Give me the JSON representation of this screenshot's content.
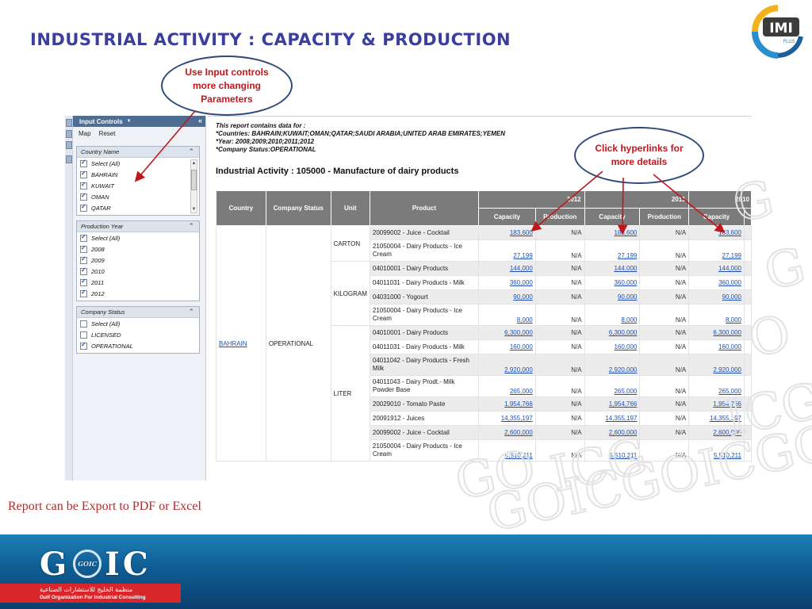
{
  "slide": {
    "title": "INDUSTRIAL ACTIVITY : CAPACITY & PRODUCTION",
    "logo_text": "IMI",
    "logo_sub": "PLUS",
    "export_note": "Report can be Export to PDF or Excel"
  },
  "callouts": {
    "input_controls": "Use Input controls more changing Parameters",
    "hyperlinks": "Click hyperlinks for more details"
  },
  "input_panel": {
    "title": "Input Controls",
    "map_label": "Map",
    "reset_label": "Reset",
    "groups": [
      {
        "title": "Country Name",
        "options": [
          {
            "label": "Select (All)",
            "checked": true
          },
          {
            "label": "BAHRAIN",
            "checked": true
          },
          {
            "label": "KUWAIT",
            "checked": true
          },
          {
            "label": "OMAN",
            "checked": true
          },
          {
            "label": "QATAR",
            "checked": true
          }
        ]
      },
      {
        "title": "Production Year",
        "options": [
          {
            "label": "Select (All)",
            "checked": true
          },
          {
            "label": "2008",
            "checked": true
          },
          {
            "label": "2009",
            "checked": true
          },
          {
            "label": "2010",
            "checked": true
          },
          {
            "label": "2011",
            "checked": true
          },
          {
            "label": "2012",
            "checked": true
          }
        ]
      },
      {
        "title": "Company Status",
        "options": [
          {
            "label": "Select (All)",
            "checked": false
          },
          {
            "label": "LICENSED",
            "checked": false
          },
          {
            "label": "OPERATIONAL",
            "checked": true
          }
        ]
      }
    ]
  },
  "report": {
    "info": [
      "This report contains data for :",
      "*Countries: BAHRAIN;KUWAIT;OMAN;QATAR;SAUDI ARABIA;UNITED ARAB EMIRATES;YEMEN",
      "*Year: 2008;2009;2010;2011;2012",
      "*Company Status:OPERATIONAL"
    ],
    "title": "Industrial Activity :   105000  -  Manufacture of dairy products",
    "headers": {
      "country": "Country",
      "company_status": "Company Status",
      "unit": "Unit",
      "product": "Product",
      "years": [
        "2012",
        "2011",
        "2010"
      ],
      "capacity": "Capacity",
      "production": "Production"
    },
    "country": "BAHRAIN",
    "status": "OPERATIONAL",
    "units": [
      {
        "unit": "CARTON",
        "rows": [
          {
            "product": "20099002  -  Juice - Cocktail",
            "cap": "183,600",
            "prod": "N/A"
          },
          {
            "product": "21050004  -  Dairy Products - Ice Cream",
            "cap": "27,199",
            "prod": "N/A"
          }
        ]
      },
      {
        "unit": "KILOGRAM",
        "rows": [
          {
            "product": "04010001  -  Dairy Products",
            "cap": "144,000",
            "prod": "N/A"
          },
          {
            "product": "04011031  -  Dairy Products - Milk",
            "cap": "360,000",
            "prod": "N/A"
          },
          {
            "product": "04031000  -  Yogourt",
            "cap": "90,000",
            "prod": "N/A"
          },
          {
            "product": "21050004  -  Dairy Products - Ice Cream",
            "cap": "8,000",
            "prod": "N/A"
          }
        ]
      },
      {
        "unit": "LITER",
        "rows": [
          {
            "product": "04010001  -  Dairy Products",
            "cap": "6,300,000",
            "prod": "N/A"
          },
          {
            "product": "04011031  -  Dairy Products - Milk",
            "cap": "160,000",
            "prod": "N/A"
          },
          {
            "product": "04011042  -  Dairy Products - Fresh Milk",
            "cap": "2,920,000",
            "prod": "N/A"
          },
          {
            "product": "04011043  -  Dairy Prodt.- Milk Powder Base",
            "cap": "265,000",
            "prod": "N/A"
          },
          {
            "product": "20029010  -  Tomato Paste",
            "cap": "1,954,766",
            "prod": "N/A"
          },
          {
            "product": "20091912  -  Juices",
            "cap": "14,355,197",
            "prod": "N/A"
          },
          {
            "product": "20099002  -  Juice - Cocktail",
            "cap": "2,600,000",
            "prod": "N/A"
          },
          {
            "product": "21050004  -  Dairy Products - Ice Cream",
            "cap": "5,510,211",
            "prod": "N/A"
          }
        ]
      }
    ]
  },
  "footer": {
    "logo_left": "G",
    "logo_ring": "GOIC",
    "logo_right": "IC",
    "org_ar": "منظمة الخليج للاستشارات الصناعية",
    "org_en": "Gulf Organization For Industrial Consulting"
  },
  "colors": {
    "title": "#3a3f9e",
    "callout_text": "#c0171c",
    "arrow": "#c0171c",
    "header_bg": "#7b7b7b",
    "link": "#1f4fb4",
    "footer_blue": "#0f5d93",
    "footer_red": "#d9262a"
  }
}
